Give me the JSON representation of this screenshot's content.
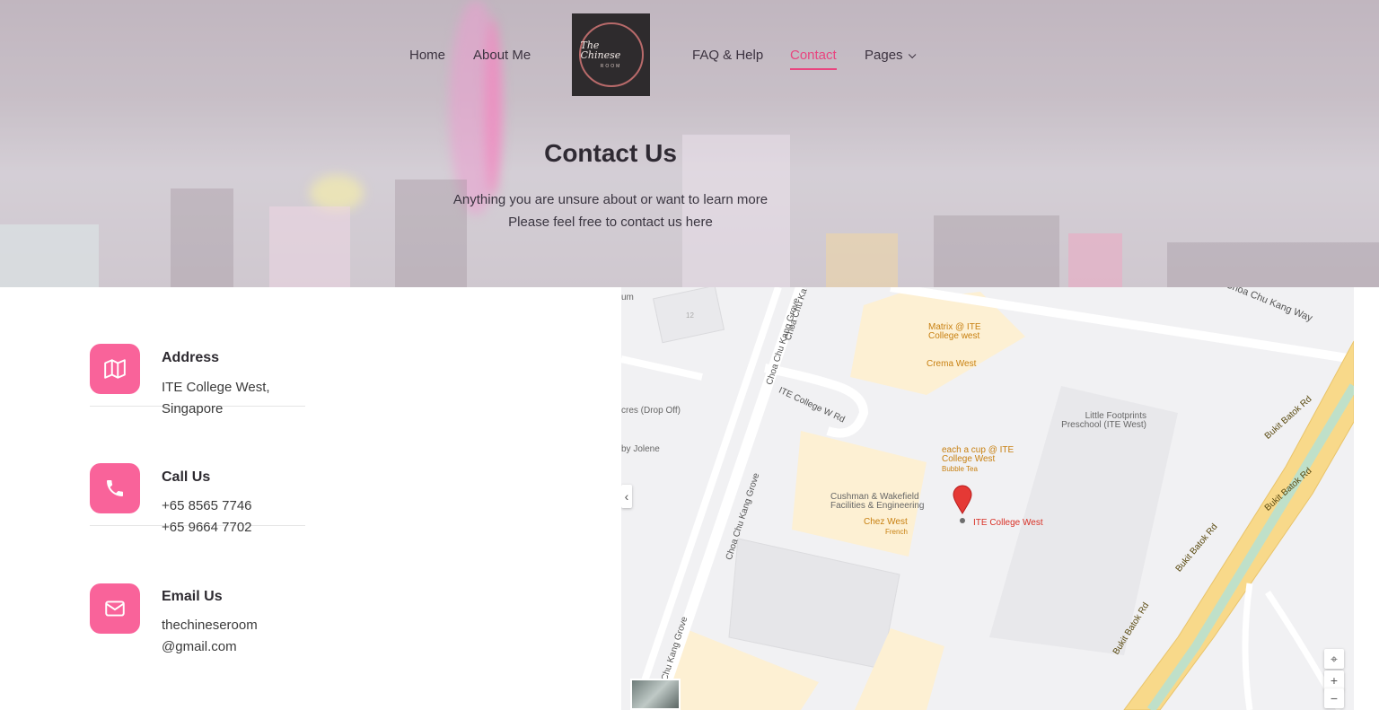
{
  "nav": {
    "items": [
      {
        "label": "Home"
      },
      {
        "label": "About Me"
      },
      {
        "label": "FAQ & Help"
      },
      {
        "label": "Contact"
      },
      {
        "label": "Pages"
      }
    ],
    "logo_text": "The Chinese",
    "logo_sub": "ROOM"
  },
  "hero": {
    "title": "Contact Us",
    "line1": "Anything you are unsure about or want to learn more",
    "line2": "Please feel free to contact us here"
  },
  "contact": [
    {
      "title": "Address",
      "lines": [
        "ITE College West,",
        "Singapore"
      ],
      "icon": "map-icon"
    },
    {
      "title": "Call Us",
      "lines": [
        "+65 8565 7746",
        "+65 9664 7702"
      ],
      "icon": "phone-icon"
    },
    {
      "title": "Email Us",
      "lines": [
        "thechineseroom",
        "@gmail.com"
      ],
      "icon": "mail-icon"
    }
  ],
  "map": {
    "labels": {
      "choa_way": "Choa Chu Kang Way",
      "matrix": "Matrix @ ITE College west",
      "crema": "Crema West",
      "little": "Little Footprints Preschool (ITE West)",
      "each": "each a cup @ ITE College West",
      "bubble": "Bubble Tea",
      "cushman": "Cushman & Wakefield Facilities & Engineering",
      "chez": "Chez West",
      "french": "French",
      "ite": "ITE College West",
      "itew": "ITE College W Rd",
      "grove": "Choa Chu Kang Grove",
      "bukit": "Bukit Batok Rd",
      "dropoff": "cres (Drop Off)",
      "jolene": "by Jolene",
      "um": "um",
      "choa_ka": "Choa Chu Ka",
      "n12": "12"
    }
  }
}
